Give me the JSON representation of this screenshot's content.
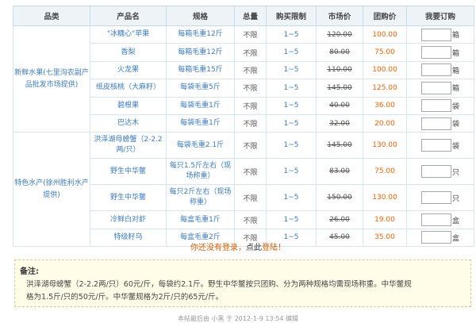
{
  "table": {
    "headers": [
      "品类",
      "产品名",
      "规格",
      "总量",
      "购买限制",
      "市场价",
      "团购价",
      "我要订购"
    ],
    "groups": [
      {
        "category": "新鲜水果(七里沟农副产品批发市场提供)",
        "rows": [
          {
            "name": "\"冰糖心\"苹果",
            "spec": "每箱毛重12斤",
            "total": "不限",
            "limit": "1~5",
            "market": "120.00",
            "group": "100.00",
            "unit": "箱"
          },
          {
            "name": "香梨",
            "spec": "每箱毛重12斤",
            "total": "不限",
            "limit": "1~5",
            "market": "80.00",
            "group": "75.00",
            "unit": "箱"
          },
          {
            "name": "火龙果",
            "spec": "每箱毛重15斤",
            "total": "不限",
            "limit": "1~5",
            "market": "110.00",
            "group": "100.00",
            "unit": "箱"
          },
          {
            "name": "纸皮核桃（大麻籽）",
            "spec": "每袋毛重5斤",
            "total": "不限",
            "limit": "1~5",
            "market": "145.00",
            "group": "125.00",
            "unit": "箱"
          },
          {
            "name": "碧根果",
            "spec": "每袋毛重1斤",
            "total": "不限",
            "limit": "1~5",
            "market": "40.00",
            "group": "36.00",
            "unit": "袋"
          },
          {
            "name": "巴达木",
            "spec": "每袋毛重1斤",
            "total": "不限",
            "limit": "1~5",
            "market": "32.00",
            "group": "20.00",
            "unit": "袋"
          }
        ]
      },
      {
        "category": "特色水产(徐州胜利水产提供)",
        "rows": [
          {
            "name": "洪泽湖母螃蟹（2-2.2两/只）",
            "spec": "每袋毛重2.1斤",
            "total": "不限",
            "limit": "1~5",
            "market": "145.00",
            "group": "130.00",
            "unit": "袋"
          },
          {
            "name": "野生中华鳖",
            "spec": "每只1.5斤左右（现场称重）",
            "total": "不限",
            "limit": "1~5",
            "market": "83.00",
            "group": "75.00",
            "unit": "只"
          },
          {
            "name": "野生中华鳖",
            "spec": "每只2斤左右（现场称重）",
            "total": "不限",
            "limit": "1~5",
            "market": "150.00",
            "group": "130.00",
            "unit": "只"
          },
          {
            "name": "冷鲜白对虾",
            "spec": "每盒毛重1斤",
            "total": "不限",
            "limit": "1~5",
            "market": "26.00",
            "group": "19.00",
            "unit": "盒"
          },
          {
            "name": "特级籽乌",
            "spec": "每盒毛重2斤",
            "total": "不限",
            "limit": "1~5",
            "market": "45.00",
            "group": "35.00",
            "unit": "盒"
          }
        ]
      }
    ]
  },
  "login_prompt": {
    "text": "你还没有登录",
    "comma": "，",
    "action_prefix": "点此",
    "link": "登陆",
    "end": "！"
  },
  "notes": {
    "title": "备注:",
    "line1": "洪泽湖母螃蟹（2-2.2两/只）60元/斤，每袋约2.1斤。野生中华鳖按只团购、分为两种规格均需现场称重。中华鳖规",
    "line2": "格为1.5斤/只的50元/斤。中华鳖规格为2斤/只的65元/斤。"
  },
  "footer": {
    "text": "本帖最后由 小黑 于 2012-1-9 13:54 编辑"
  },
  "colors": {
    "link": "#3a7bbf",
    "group_price": "#f06000",
    "header_bg": "#eef3f8",
    "border": "#d6e4f0",
    "notes_bg": "#fffde8"
  }
}
